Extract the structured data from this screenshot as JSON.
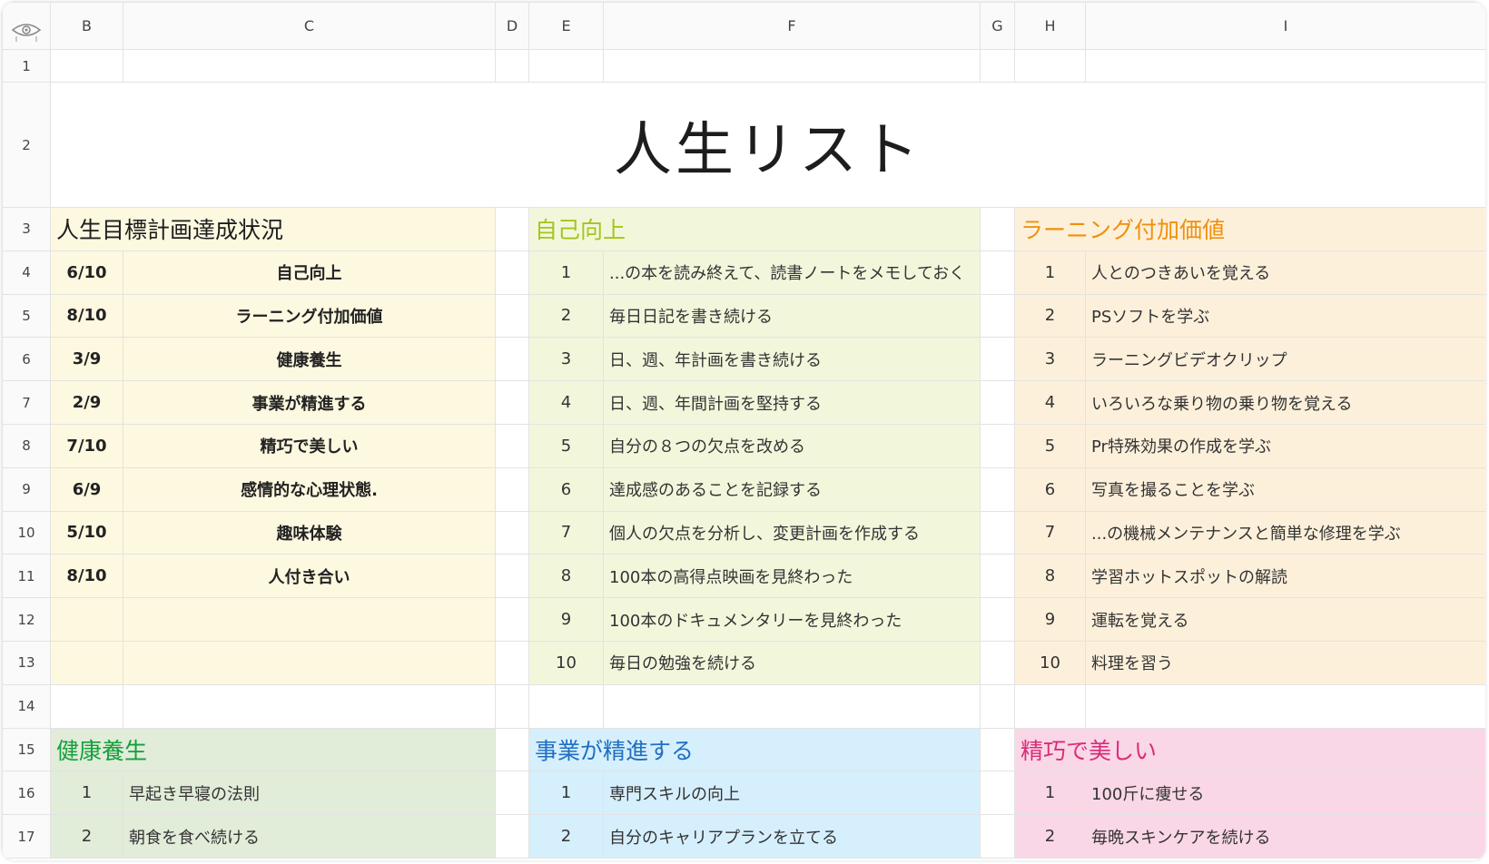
{
  "columns": [
    "B",
    "C",
    "D",
    "E",
    "F",
    "G",
    "H",
    "I"
  ],
  "row_numbers": [
    "1",
    "2",
    "3",
    "4",
    "5",
    "6",
    "7",
    "8",
    "9",
    "10",
    "11",
    "12",
    "13",
    "14",
    "15",
    "16",
    "17"
  ],
  "title": "人生リスト",
  "colors": {
    "summary_bg": "#fdf8e0",
    "self_improvement_bg": "#f2f7dc",
    "self_improvement_title": "#a3c51a",
    "learning_bg": "#fdf0db",
    "learning_title": "#f0900c",
    "health_bg": "#e1ecd9",
    "health_title": "#14a03a",
    "business_bg": "#d6effc",
    "business_title": "#1f6fc2",
    "beauty_bg": "#fad7e6",
    "beauty_title": "#d92d7a"
  },
  "summary": {
    "title": "人生目標計画達成状況",
    "rows": [
      {
        "score": "6/10",
        "label": "自己向上"
      },
      {
        "score": "8/10",
        "label": "ラーニング付加価値"
      },
      {
        "score": "3/9",
        "label": "健康養生"
      },
      {
        "score": "2/9",
        "label": "事業が精進する"
      },
      {
        "score": "7/10",
        "label": "精巧で美しい"
      },
      {
        "score": "6/9",
        "label": "感情的な心理状態."
      },
      {
        "score": "5/10",
        "label": "趣味体験"
      },
      {
        "score": "8/10",
        "label": "人付き合い"
      }
    ]
  },
  "self_improvement": {
    "title": "自己向上",
    "items": [
      {
        "no": "1",
        "text": "...の本を読み終えて、読書ノートをメモしておく"
      },
      {
        "no": "2",
        "text": "毎日日記を書き続ける"
      },
      {
        "no": "3",
        "text": "日、週、年計画を書き続ける"
      },
      {
        "no": "4",
        "text": "日、週、年間計画を堅持する"
      },
      {
        "no": "5",
        "text": "自分の８つの欠点を改める"
      },
      {
        "no": "6",
        "text": "達成感のあることを記録する"
      },
      {
        "no": "7",
        "text": "個人の欠点を分析し、変更計画を作成する"
      },
      {
        "no": "8",
        "text": "100本の高得点映画を見終わった"
      },
      {
        "no": "9",
        "text": "100本のドキュメンタリーを見終わった"
      },
      {
        "no": "10",
        "text": "毎日の勉強を続ける"
      }
    ]
  },
  "learning": {
    "title": "ラーニング付加価値",
    "items": [
      {
        "no": "1",
        "text": "人とのつきあいを覚える"
      },
      {
        "no": "2",
        "text": "PSソフトを学ぶ"
      },
      {
        "no": "3",
        "text": "ラーニングビデオクリップ"
      },
      {
        "no": "4",
        "text": "いろいろな乗り物の乗り物を覚える"
      },
      {
        "no": "5",
        "text": "Pr特殊効果の作成を学ぶ"
      },
      {
        "no": "6",
        "text": "写真を撮ることを学ぶ"
      },
      {
        "no": "7",
        "text": "...の機械メンテナンスと簡単な修理を学ぶ"
      },
      {
        "no": "8",
        "text": "学習ホットスポットの解読"
      },
      {
        "no": "9",
        "text": "運転を覚える"
      },
      {
        "no": "10",
        "text": "料理を習う"
      }
    ]
  },
  "health": {
    "title": "健康養生",
    "items": [
      {
        "no": "1",
        "text": "早起き早寝の法則"
      },
      {
        "no": "2",
        "text": "朝食を食べ続ける"
      }
    ]
  },
  "business": {
    "title": "事業が精進する",
    "items": [
      {
        "no": "1",
        "text": "専門スキルの向上"
      },
      {
        "no": "2",
        "text": "自分のキャリアプランを立てる"
      }
    ]
  },
  "beauty": {
    "title": "精巧で美しい",
    "items": [
      {
        "no": "1",
        "text": "100斤に痩せる"
      },
      {
        "no": "2",
        "text": "毎晩スキンケアを続ける"
      }
    ]
  }
}
